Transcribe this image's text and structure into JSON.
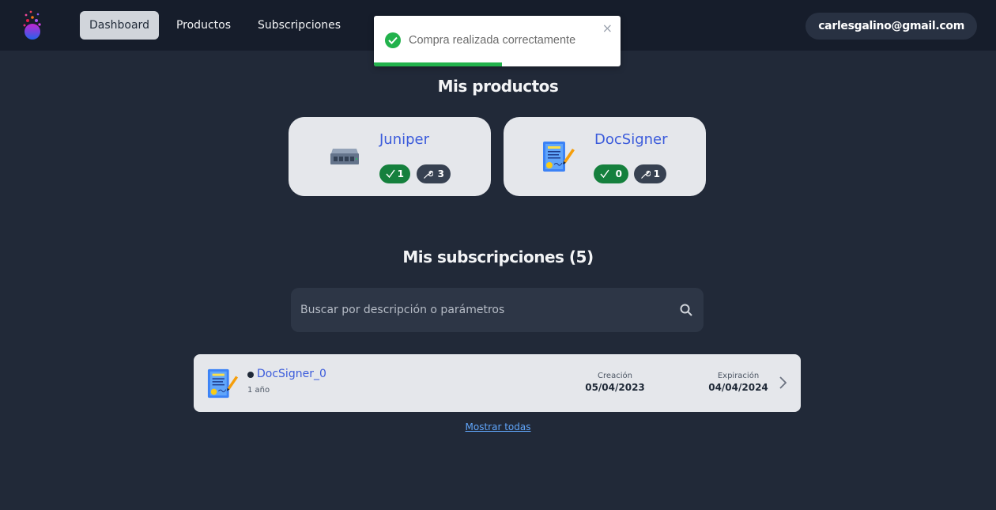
{
  "header": {
    "nav": [
      {
        "label": "Dashboard",
        "active": true
      },
      {
        "label": "Productos",
        "active": false
      },
      {
        "label": "Subscripciones",
        "active": false
      }
    ],
    "user_email": "carlesgalino@gmail.com"
  },
  "toast": {
    "message": "Compra realizada correctamente",
    "close_glyph": "×",
    "progress": 0.52,
    "color": "#22b24c"
  },
  "products": {
    "title": "Mis productos",
    "items": [
      {
        "name": "Juniper",
        "icon": "network-switch-icon",
        "active_count": "1",
        "tools_count": "3"
      },
      {
        "name": "DocSigner",
        "icon": "signed-document-icon",
        "active_count": "0",
        "tools_count": "1"
      }
    ]
  },
  "subscriptions": {
    "title": "Mis subscripciones (5)",
    "search_placeholder": "Buscar por descripción o parámetros",
    "rows": [
      {
        "name": "DocSigner_0",
        "icon": "signed-document-icon",
        "duration": "1 año",
        "created_label": "Creación",
        "created": "05/04/2023",
        "expires_label": "Expiración",
        "expires": "04/04/2024"
      }
    ],
    "show_all": "Mostrar todas"
  },
  "colors": {
    "background": "#212938",
    "header": "#161d2b",
    "card": "#e5e7eb",
    "link": "#3b5bdb",
    "success": "#15803d"
  }
}
